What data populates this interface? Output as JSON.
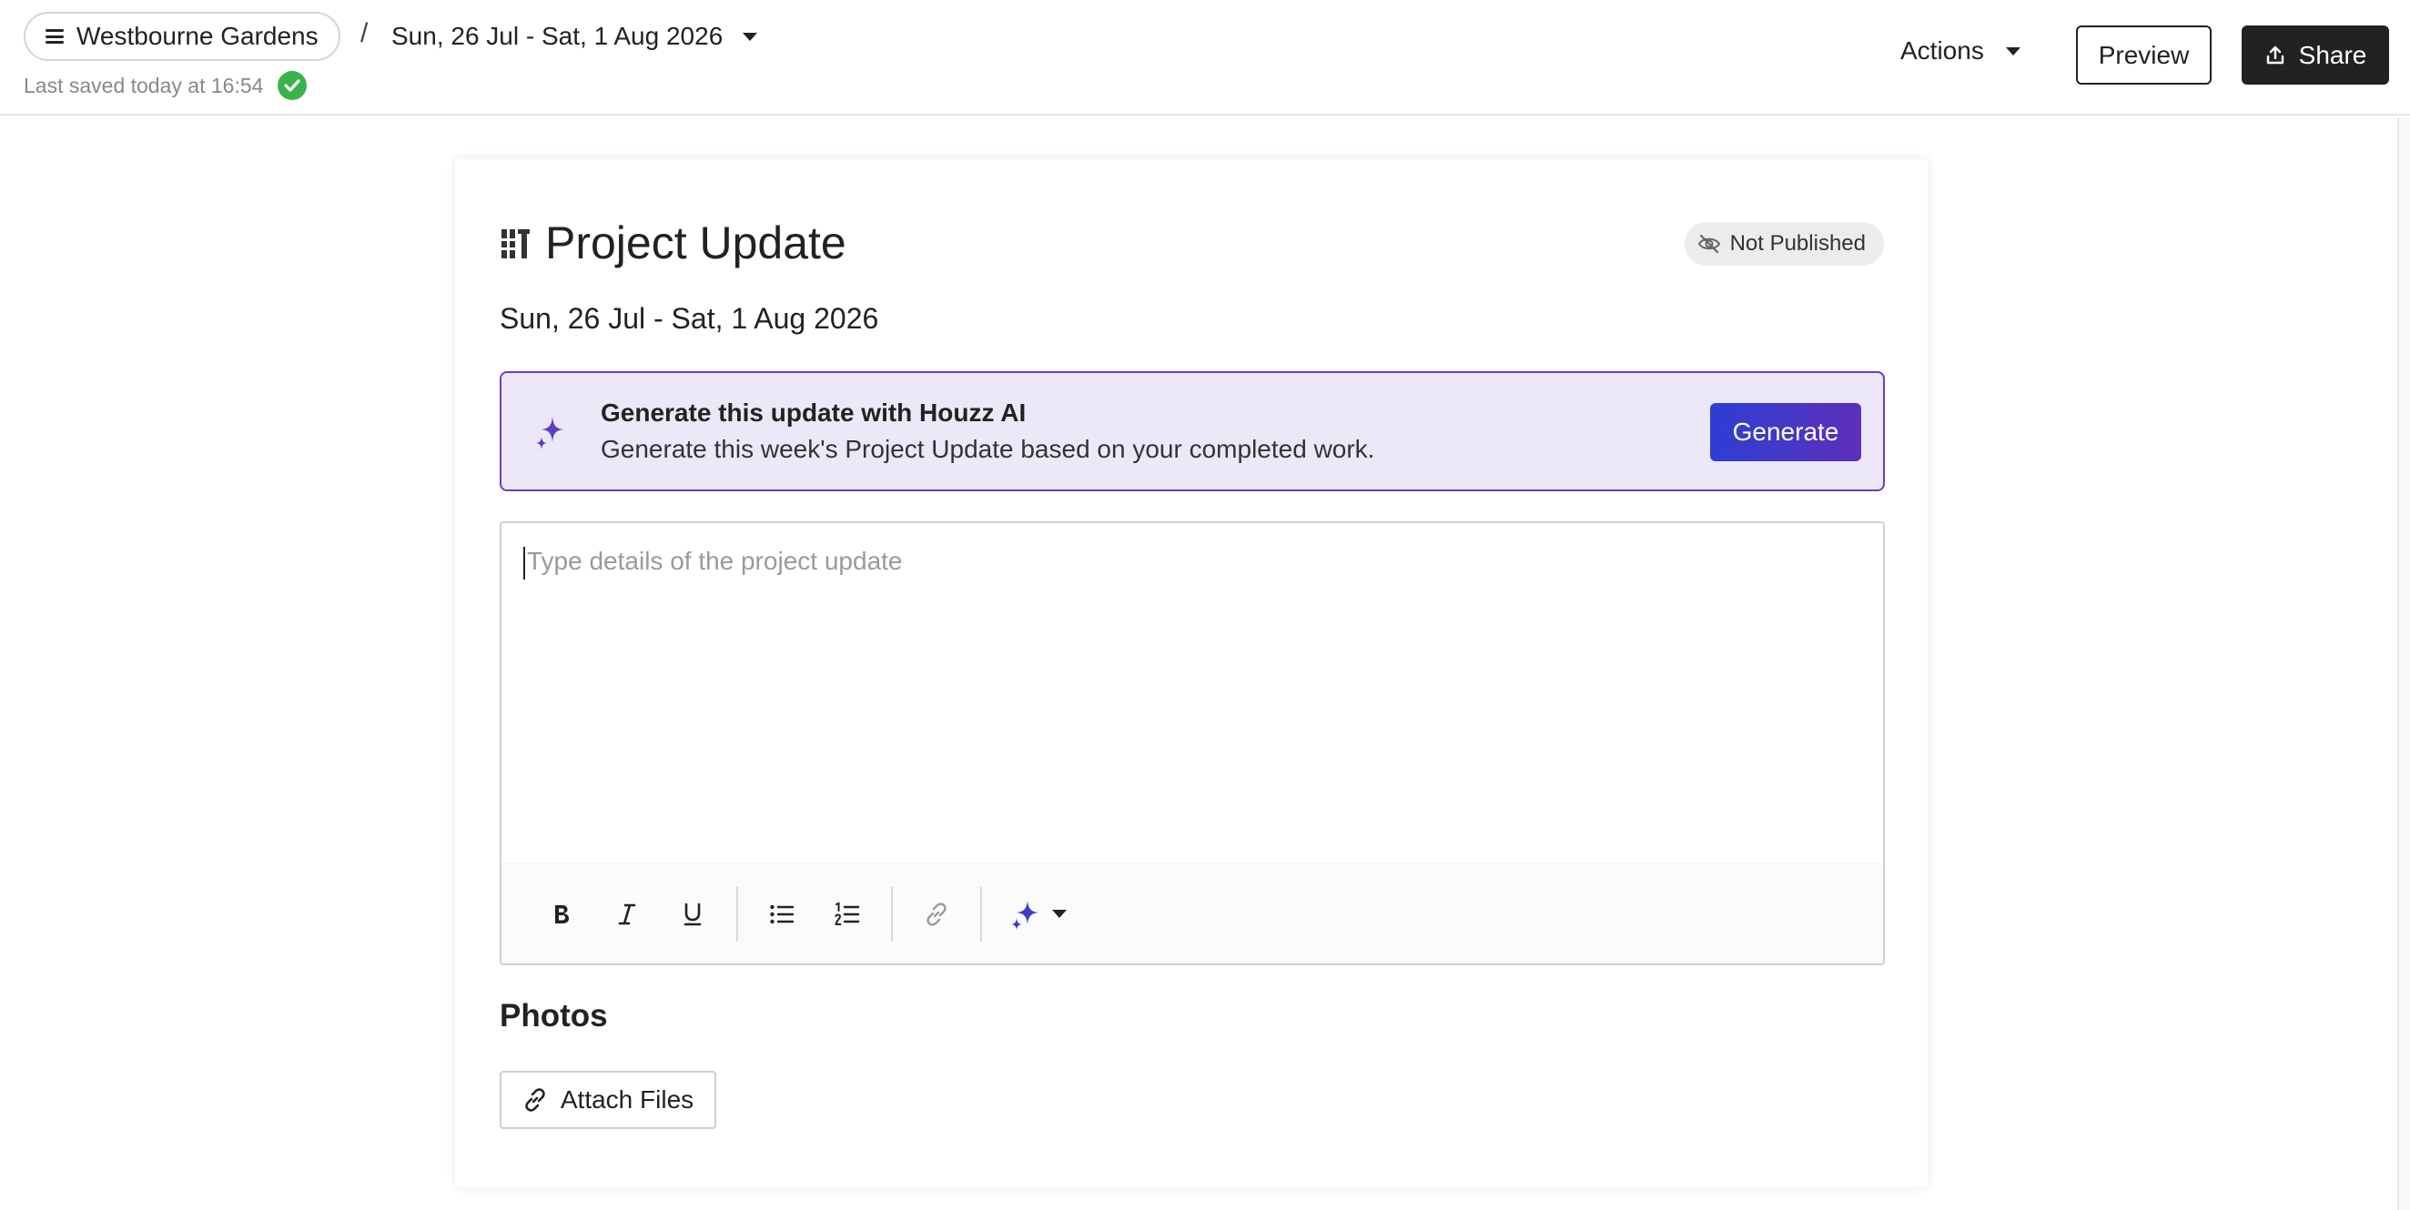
{
  "header": {
    "project_name": "Westbourne Gardens",
    "separator": "/",
    "date_range": "Sun, 26 Jul - Sat, 1 Aug 2026",
    "last_saved": "Last saved today at 16:54",
    "actions_label": "Actions",
    "preview_label": "Preview",
    "share_label": "Share"
  },
  "update": {
    "title": "Project Update",
    "status": "Not Published",
    "date_heading": "Sun, 26 Jul - Sat, 1 Aug 2026"
  },
  "ai_banner": {
    "title": "Generate this update with Houzz AI",
    "description": "Generate this week's Project Update based on your completed work.",
    "button_label": "Generate"
  },
  "editor": {
    "placeholder": "Type details of the project update",
    "toolbar": [
      "bold-icon",
      "italic-icon",
      "underline-icon",
      "bullet-list-icon",
      "numbered-list-icon",
      "link-icon",
      "ai-sparkle-icon",
      "chevron-down-icon"
    ]
  },
  "photos": {
    "heading": "Photos",
    "attach_label": "Attach Files"
  },
  "colors": {
    "accent_purple": "#6a3ec0",
    "banner_bg": "#ece8f8",
    "generate_gradient_start": "#2e3ed4",
    "generate_gradient_end": "#5e2eb8",
    "success_green": "#3bb34a",
    "dark_button": "#222222"
  }
}
